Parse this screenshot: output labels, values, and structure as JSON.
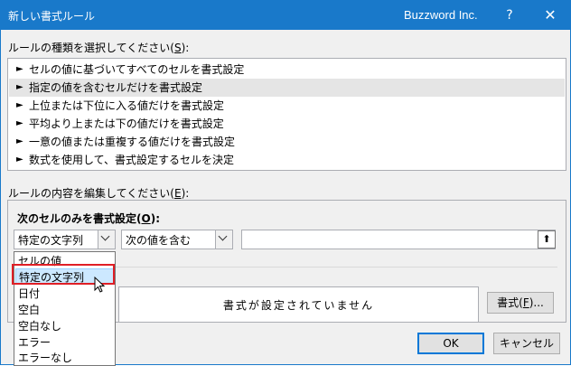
{
  "window": {
    "title": "新しい書式ルール",
    "brand": "Buzzword Inc.",
    "help": "?",
    "close": "✕"
  },
  "rule_type": {
    "label_prefix": "ルールの種類を選択してください(",
    "label_key": "S",
    "label_suffix": "):",
    "items": [
      "セルの値に基づいてすべてのセルを書式設定",
      "指定の値を含むセルだけを書式設定",
      "上位または下位に入る値だけを書式設定",
      "平均より上または下の値だけを書式設定",
      "一意の値または重複する値だけを書式設定",
      "数式を使用して、書式設定するセルを決定"
    ],
    "selected_index": 1,
    "bullet": "►"
  },
  "edit": {
    "label_prefix": "ルールの内容を編集してください(",
    "label_key": "E",
    "label_suffix": "):",
    "header_prefix": "次のセルのみを書式設定(",
    "header_key": "O",
    "header_suffix": "):",
    "combo1_value": "特定の文字列",
    "combo2_value": "次の値を含む",
    "text_value": "",
    "up_icon": "⬆"
  },
  "dropdown": {
    "options": [
      "セルの値",
      "特定の文字列",
      "日付",
      "空白",
      "空白なし",
      "エラー",
      "エラーなし"
    ],
    "highlighted_index": 1
  },
  "preview": {
    "text": "書式が設定されていません"
  },
  "buttons": {
    "format_prefix": "書式(",
    "format_key": "F",
    "format_suffix": ")...",
    "ok": "OK",
    "cancel": "キャンセル"
  }
}
